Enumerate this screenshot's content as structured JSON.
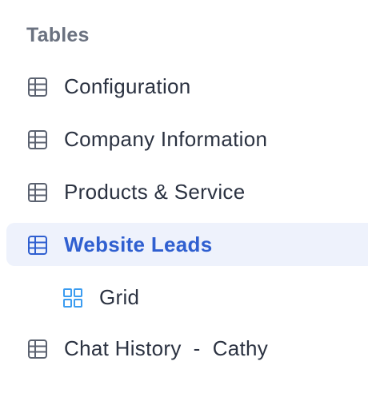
{
  "sidebar": {
    "section_title": "Tables",
    "items": [
      {
        "label": "Configuration",
        "icon": "table-icon"
      },
      {
        "label": "Company Information",
        "icon": "table-icon"
      },
      {
        "label": "Products & Service",
        "icon": "table-icon"
      },
      {
        "label": "Website Leads",
        "icon": "table-icon",
        "active": true
      },
      {
        "label": "Grid",
        "icon": "grid-view-icon",
        "sub": true
      },
      {
        "label": "Chat History  -  Cathy",
        "icon": "table-icon"
      }
    ]
  },
  "colors": {
    "text": "#2b3241",
    "muted": "#6b7280",
    "accent": "#2f5fd0",
    "active_bg": "#eef2fc",
    "grid_icon": "#3b9cf0",
    "icon_gray": "#5b6270"
  }
}
